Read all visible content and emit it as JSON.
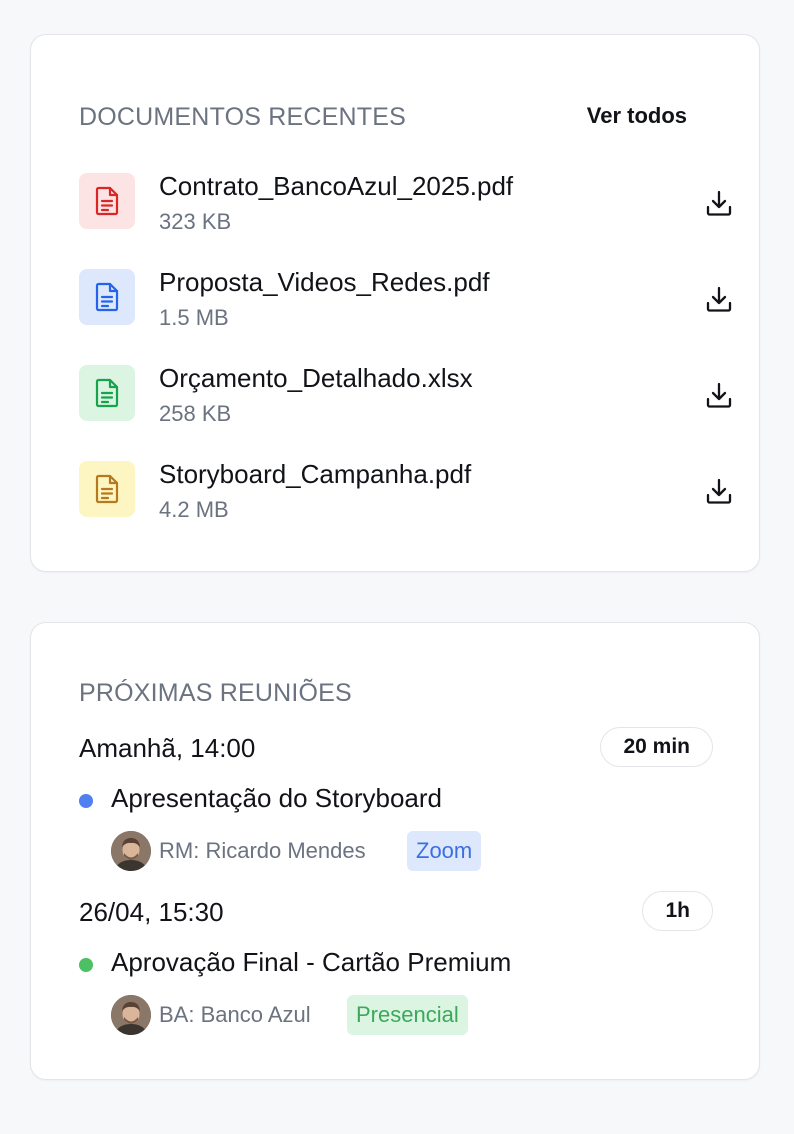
{
  "recent_documents": {
    "title": "DOCUMENTOS RECENTES",
    "see_all_label": "Ver todos",
    "items": [
      {
        "name": "Contrato_BancoAzul_2025.pdf",
        "size": "323 KB",
        "icon": "file-text-icon",
        "color": "#dc2626",
        "bg": "#fde4e4"
      },
      {
        "name": "Proposta_Videos_Redes.pdf",
        "size": "1.5 MB",
        "icon": "file-text-icon",
        "color": "#2563eb",
        "bg": "#dde8fd"
      },
      {
        "name": "Orçamento_Detalhado.xlsx",
        "size": "258 KB",
        "icon": "file-text-icon",
        "color": "#16a34a",
        "bg": "#dcf5e3"
      },
      {
        "name": "Storyboard_Campanha.pdf",
        "size": "4.2 MB",
        "icon": "file-text-icon",
        "color": "#b7791f",
        "bg": "#fdf6c3"
      }
    ],
    "download_icon": "download-icon"
  },
  "upcoming_meetings": {
    "title": "PRÓXIMAS REUNIÕES",
    "items": [
      {
        "date": "Amanhã, 14:00",
        "duration": "20 min",
        "title": "Apresentação do Storyboard",
        "dot_color": "#4f7ff0",
        "who": "RM: Ricardo Mendes",
        "tag": "Zoom",
        "tag_color": "#3b6fe0",
        "tag_bg": "#dde8fd"
      },
      {
        "date": "26/04, 15:30",
        "duration": "1h",
        "title": "Aprovação Final - Cartão Premium",
        "dot_color": "#4cc062",
        "who": "BA: Banco Azul",
        "tag": "Presencial",
        "tag_color": "#3ca85a",
        "tag_bg": "#dcf5e3"
      }
    ]
  },
  "colors": {
    "background": "#f7f8fa",
    "card": "#ffffff",
    "muted_text": "#6b7280",
    "text": "#111318"
  }
}
